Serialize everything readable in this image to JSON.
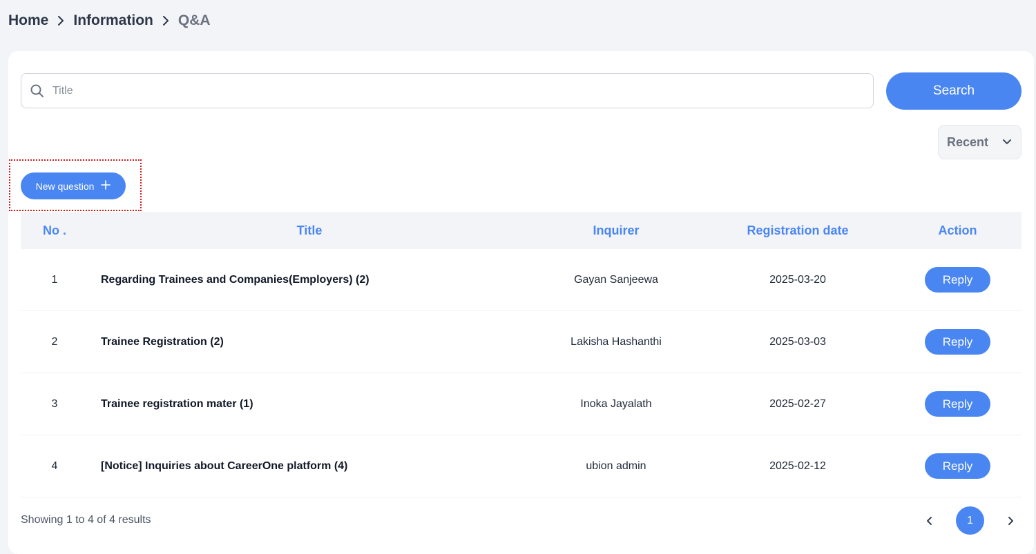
{
  "breadcrumb": {
    "items": [
      "Home",
      "Information",
      "Q&A"
    ]
  },
  "search": {
    "placeholder": "Title",
    "value": "",
    "button_label": "Search"
  },
  "sort": {
    "selected": "Recent"
  },
  "actions": {
    "new_question_label": "New question"
  },
  "table": {
    "headers": {
      "no": "No .",
      "title": "Title",
      "inquirer": "Inquirer",
      "date": "Registration date",
      "action": "Action"
    },
    "rows": [
      {
        "no": "1",
        "title": "Regarding Trainees and Companies(Employers) (2)",
        "inquirer": "Gayan Sanjeewa",
        "date": "2025-03-20",
        "action": "Reply"
      },
      {
        "no": "2",
        "title": "Trainee Registration (2)",
        "inquirer": "Lakisha Hashanthi",
        "date": "2025-03-03",
        "action": "Reply"
      },
      {
        "no": "3",
        "title": "Trainee registration mater (1)",
        "inquirer": "Inoka Jayalath",
        "date": "2025-02-27",
        "action": "Reply"
      },
      {
        "no": "4",
        "title": "[Notice] Inquiries about CareerOne platform (4)",
        "inquirer": "ubion admin",
        "date": "2025-02-12",
        "action": "Reply"
      }
    ]
  },
  "footer": {
    "results_text": "Showing 1 to 4 of 4 results",
    "current_page": "1"
  },
  "colors": {
    "accent": "#4a86f1",
    "background": "#f3f4f8",
    "highlight_outline": "#d11a1a"
  },
  "icons": {
    "search": "search-icon",
    "breadcrumb_separator": "chevron-right-icon",
    "sort": "chevron-down-icon",
    "new_question": "plus-icon",
    "prev": "chevron-left-icon",
    "next": "chevron-right-icon"
  }
}
